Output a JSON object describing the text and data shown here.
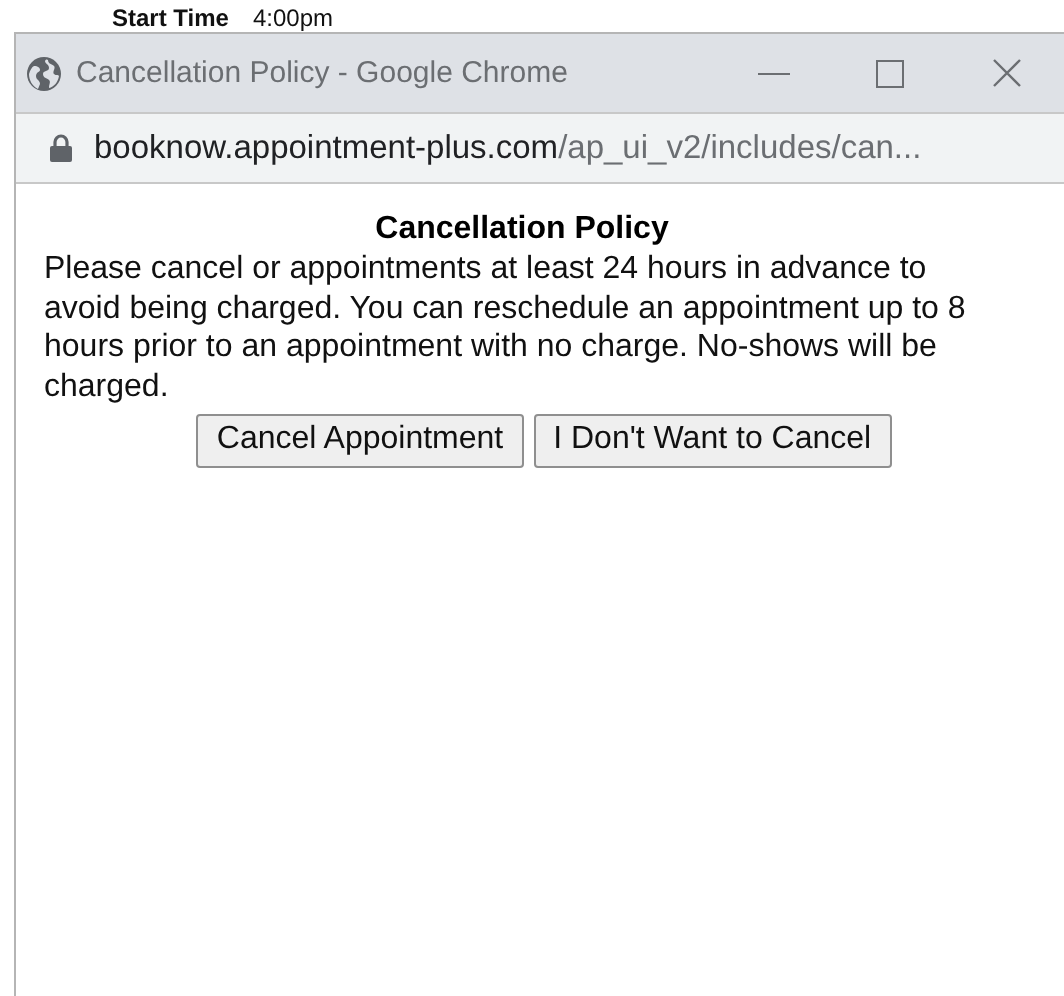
{
  "background": {
    "label": "Start Time",
    "value": "4:00pm"
  },
  "window": {
    "title": "Cancellation Policy - Google Chrome"
  },
  "address_bar": {
    "host": "booknow.appointment-plus.com",
    "path": "/ap_ui_v2/includes/can..."
  },
  "dialog": {
    "heading": "Cancellation Policy",
    "message": "Please cancel or appointments at least 24 hours in advance to avoid being charged. You can reschedule an appointment up to 8 hours prior to an appointment with no charge. No-shows will be charged.",
    "buttons": [
      "Cancel Appointment",
      "I Don't Want to Cancel"
    ]
  }
}
